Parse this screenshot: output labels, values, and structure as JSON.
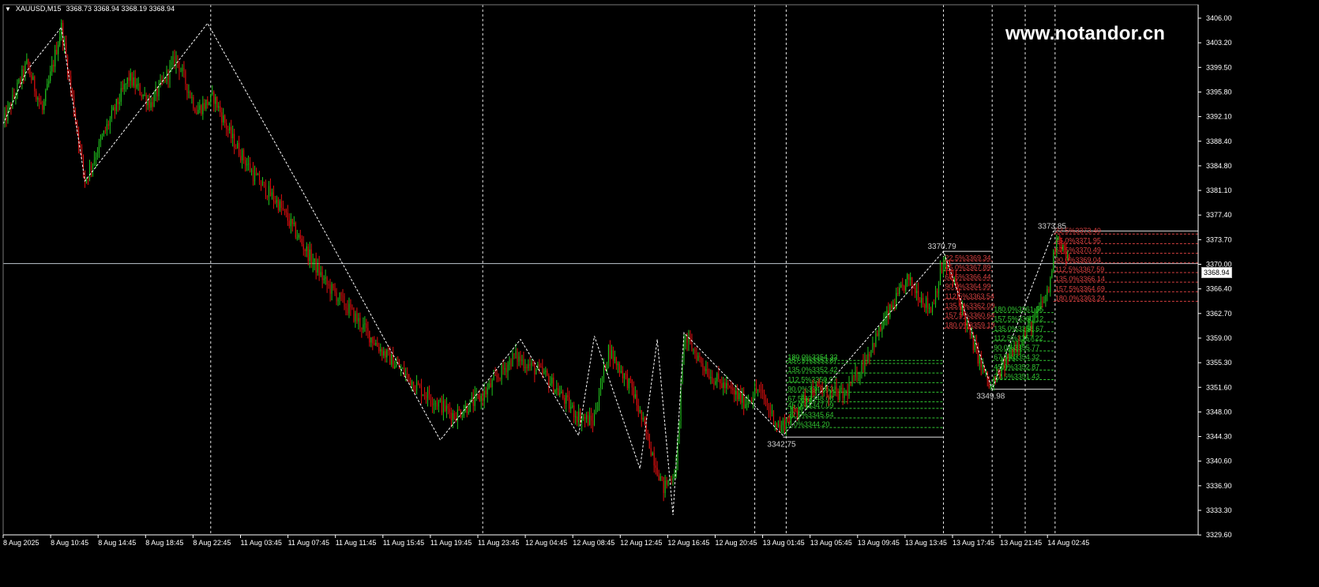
{
  "window": {
    "title": "XAUUSD,M15",
    "ohlc": "3368.73 3368.94 3368.19 3368.94",
    "watermark": "www.notandor.cn",
    "current_price": "3368.94"
  },
  "colors": {
    "background": "#000000",
    "bull": "#22c51e",
    "bear": "#e01010",
    "zigzag": "#ffffff",
    "green_levels": "#32c832",
    "red_levels": "#d84040",
    "grid": "#ffffff"
  },
  "chart_data": {
    "type": "candlestick",
    "symbol": "XAUUSD",
    "timeframe": "M15",
    "ylim": [
      3328.0,
      3408.0
    ],
    "y_ticks": [
      "3406.00",
      "3403.20",
      "3399.50",
      "3395.80",
      "3392.10",
      "3388.40",
      "3384.80",
      "3381.10",
      "3377.40",
      "3373.70",
      "3370.00",
      "3366.40",
      "3362.70",
      "3359.00",
      "3355.30",
      "3351.60",
      "3348.00",
      "3344.30",
      "3340.60",
      "3336.90",
      "3333.30",
      "3329.60"
    ],
    "x_ticks": [
      "8 Aug 2025",
      "8 Aug 10:45",
      "8 Aug 14:45",
      "8 Aug 18:45",
      "8 Aug 22:45",
      "11 Aug 03:45",
      "11 Aug 07:45",
      "11 Aug 11:45",
      "11 Aug 15:45",
      "11 Aug 19:45",
      "11 Aug 23:45",
      "12 Aug 04:45",
      "12 Aug 08:45",
      "12 Aug 12:45",
      "12 Aug 16:45",
      "12 Aug 20:45",
      "13 Aug 01:45",
      "13 Aug 05:45",
      "13 Aug 09:45",
      "13 Aug 13:45",
      "13 Aug 17:45",
      "13 Aug 21:45",
      "14 Aug 02:45"
    ],
    "path": [
      [
        0,
        3390.0
      ],
      [
        15,
        3399.0
      ],
      [
        25,
        3392.0
      ],
      [
        37,
        3404.6
      ],
      [
        52,
        3381.5
      ],
      [
        65,
        3389.0
      ],
      [
        80,
        3397.0
      ],
      [
        94,
        3393.0
      ],
      [
        110,
        3400.0
      ],
      [
        123,
        3392.0
      ],
      [
        134,
        3394.0
      ],
      [
        145,
        3388.0
      ],
      [
        160,
        3382.0
      ],
      [
        175,
        3378.0
      ],
      [
        190,
        3372.0
      ],
      [
        205,
        3366.0
      ],
      [
        220,
        3362.0
      ],
      [
        240,
        3356.0
      ],
      [
        265,
        3350.0
      ],
      [
        287,
        3346.0
      ],
      [
        305,
        3349.0
      ],
      [
        325,
        3355.0
      ],
      [
        345,
        3352.0
      ],
      [
        365,
        3346.0
      ],
      [
        375,
        3345.0
      ],
      [
        385,
        3356.0
      ],
      [
        400,
        3350.0
      ],
      [
        420,
        3335.0
      ],
      [
        428,
        3338.0
      ],
      [
        433,
        3358.0
      ],
      [
        450,
        3352.0
      ],
      [
        472,
        3348.0
      ],
      [
        480,
        3350.0
      ],
      [
        494,
        3344.0
      ],
      [
        515,
        3350.0
      ],
      [
        535,
        3349.0
      ],
      [
        545,
        3353.0
      ],
      [
        560,
        3360.0
      ],
      [
        575,
        3366.5
      ],
      [
        590,
        3362.0
      ],
      [
        598,
        3369.0
      ],
      [
        605,
        3366.0
      ],
      [
        615,
        3358.0
      ],
      [
        628,
        3350.0
      ],
      [
        642,
        3356.0
      ],
      [
        655,
        3360.0
      ],
      [
        665,
        3365.0
      ],
      [
        670,
        3373.5
      ],
      [
        678,
        3369.0
      ]
    ],
    "zigzag_points": [
      [
        0,
        3390.0
      ],
      [
        15,
        3398.0
      ],
      [
        37,
        3404.6
      ],
      [
        52,
        3381.4
      ],
      [
        130,
        3405.2
      ],
      [
        190,
        3380.0
      ],
      [
        278,
        3342.3
      ],
      [
        329,
        3357.5
      ],
      [
        366,
        3343.0
      ],
      [
        376,
        3358.0
      ],
      [
        405,
        3338.0
      ],
      [
        416,
        3357.5
      ],
      [
        426,
        3331.0
      ],
      [
        433,
        3358.5
      ],
      [
        496,
        3343.0
      ],
      [
        598,
        3370.79
      ],
      [
        629,
        3349.98
      ],
      [
        668,
        3373.85
      ]
    ],
    "annotations": [
      {
        "label": "3342.75",
        "x": 496,
        "y": 3342.75
      },
      {
        "label": "3370.79",
        "x": 598,
        "y": 3370.79
      },
      {
        "label": "3349.98",
        "x": 629,
        "y": 3349.98
      },
      {
        "label": "3373.85",
        "x": 668,
        "y": 3373.85
      }
    ],
    "horizontal_lines": [
      {
        "x0": 496,
        "x1": 598,
        "y": 3342.75
      },
      {
        "x0": 598,
        "x1": 629,
        "y": 3370.79
      },
      {
        "x0": 629,
        "x1": 668,
        "y": 3349.98
      },
      {
        "x0": 668,
        "x1": 760,
        "y": 3373.85
      }
    ],
    "vertical_lines": [
      132,
      305,
      478,
      498,
      598,
      629,
      650,
      669
    ],
    "fib_green_1": [
      {
        "label": "180.0",
        "value": "3354.32"
      },
      {
        "label": "157.5",
        "value": "3353.87"
      },
      {
        "label": "135.0",
        "value": "3352.42"
      },
      {
        "label": "112.5",
        "value": "3350.97"
      },
      {
        "label": "90.0",
        "value": "3349.53"
      },
      {
        "label": "67.5",
        "value": "3348.08"
      },
      {
        "label": "45.0",
        "value": "3347.09"
      },
      {
        "label": "22.5",
        "value": "3345.64"
      },
      {
        "label": "0.0",
        "value": "3344.20"
      }
    ],
    "fib_red_1": [
      {
        "label": "22.5",
        "value": "3369.34"
      },
      {
        "label": "45.0",
        "value": "3367.89"
      },
      {
        "label": "67.5",
        "value": "3366.44"
      },
      {
        "label": "90.0",
        "value": "3364.99"
      },
      {
        "label": "112.5",
        "value": "3363.54"
      },
      {
        "label": "135.0",
        "value": "3362.09"
      },
      {
        "label": "157.5",
        "value": "3360.64"
      },
      {
        "label": "180.0",
        "value": "3359.19"
      }
    ],
    "fib_green_2": [
      {
        "label": "180.0",
        "value": "3361.55"
      },
      {
        "label": "157.5",
        "value": "3360.12"
      },
      {
        "label": "135.0",
        "value": "3358.67"
      },
      {
        "label": "112.5",
        "value": "3357.22"
      },
      {
        "label": "90.0",
        "value": "3355.77"
      },
      {
        "label": "67.5",
        "value": "3354.32"
      },
      {
        "label": "45.0",
        "value": "3352.87"
      },
      {
        "label": "22.5",
        "value": "3351.43"
      }
    ],
    "fib_red_2": [
      {
        "label": "22.5",
        "value": "3373.40"
      },
      {
        "label": "45.0",
        "value": "3371.95"
      },
      {
        "label": "67.5",
        "value": "3370.49"
      },
      {
        "label": "90.0",
        "value": "3369.04"
      },
      {
        "label": "112.5",
        "value": "3367.59"
      },
      {
        "label": "135.0",
        "value": "3366.14"
      },
      {
        "label": "157.5",
        "value": "3364.69"
      },
      {
        "label": "180.0",
        "value": "3363.24"
      }
    ],
    "current_price": 3368.94
  }
}
